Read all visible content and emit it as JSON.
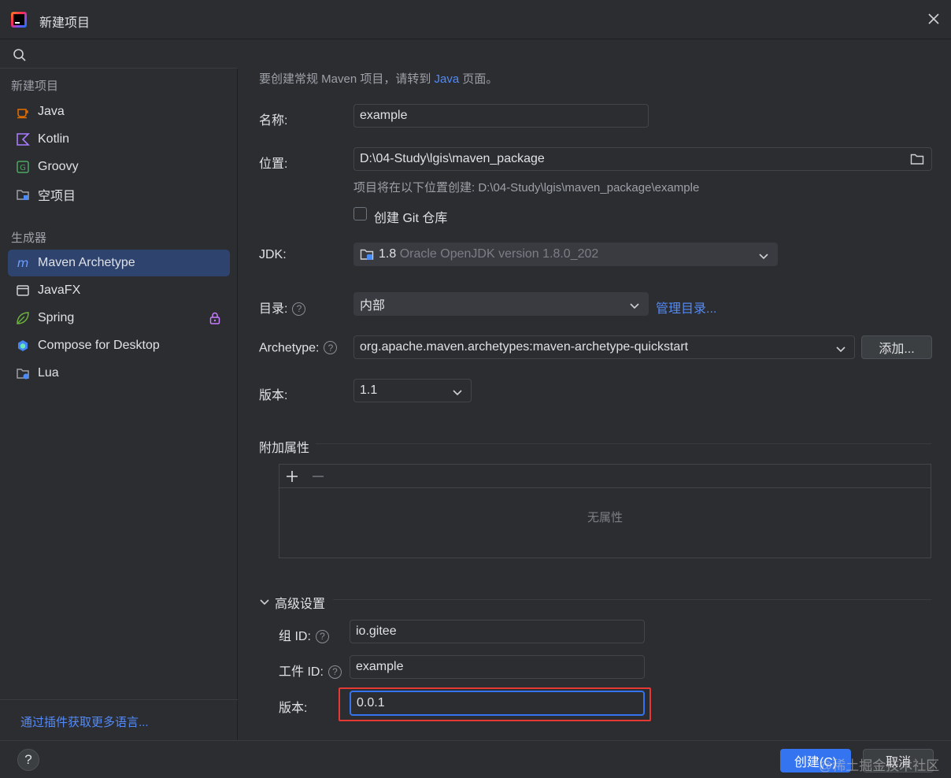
{
  "window": {
    "title": "新建项目",
    "logo_icon": "intellij-idea-logo"
  },
  "sidebar": {
    "search_placeholder": "",
    "new_project_header": "新建项目",
    "new_project_items": [
      {
        "label": "Java",
        "icon": "java-cup-icon",
        "color": "#e76f00"
      },
      {
        "label": "Kotlin",
        "icon": "kotlin-icon",
        "color": "#a97bff"
      },
      {
        "label": "Groovy",
        "icon": "groovy-icon",
        "color": "#4ea864"
      },
      {
        "label": "空项目",
        "icon": "folder-icon",
        "color": "#9da0a8"
      }
    ],
    "generators_header": "生成器",
    "generator_items": [
      {
        "label": "Maven Archetype",
        "icon": "maven-icon",
        "color": "#4c8cf8",
        "selected": true
      },
      {
        "label": "JavaFX",
        "icon": "window-icon",
        "color": "#cfd1d5"
      },
      {
        "label": "Spring",
        "icon": "spring-leaf-icon",
        "color": "#6db33f",
        "locked": true
      },
      {
        "label": "Compose for Desktop",
        "icon": "compose-icon",
        "color": "#4285f4"
      },
      {
        "label": "Lua",
        "icon": "lua-icon",
        "color": "#9da0a8"
      }
    ],
    "plugin_link": "通过插件获取更多语言..."
  },
  "form": {
    "hint_prefix": "要创建常规 Maven 项目，请转到 ",
    "hint_link": "Java",
    "hint_suffix": " 页面。",
    "name_label": "名称:",
    "name_value": "example",
    "location_label": "位置:",
    "location_value": "D:\\04-Study\\lgis\\maven_package",
    "location_hint": "项目将在以下位置创建: D:\\04-Study\\lgis\\maven_package\\example",
    "git_checkbox_label": "创建 Git 仓库",
    "git_checked": false,
    "jdk_label": "JDK:",
    "jdk_version": "1.8",
    "jdk_detail": "Oracle OpenJDK version 1.8.0_202",
    "catalog_label": "目录:",
    "catalog_value": "内部",
    "catalog_link": "管理目录...",
    "archetype_label": "Archetype:",
    "archetype_value": "org.apache.maven.archetypes:maven-archetype-quickstart",
    "archetype_add_button": "添加...",
    "version_label": "版本:",
    "version_value": "1.1",
    "extra_props_header": "附加属性",
    "extra_props_empty": "无属性",
    "advanced_header": "高级设置",
    "group_id_label": "组 ID:",
    "group_id_value": "io.gitee",
    "artifact_id_label": "工件 ID:",
    "artifact_id_value": "example",
    "adv_version_label": "版本:",
    "adv_version_value": "0.0.1",
    "help_glyph": "?"
  },
  "footer": {
    "help_glyph": "?",
    "create_button": "创建(C)",
    "cancel_button": "取消",
    "watermark": "@稀土掘金技术社区"
  }
}
